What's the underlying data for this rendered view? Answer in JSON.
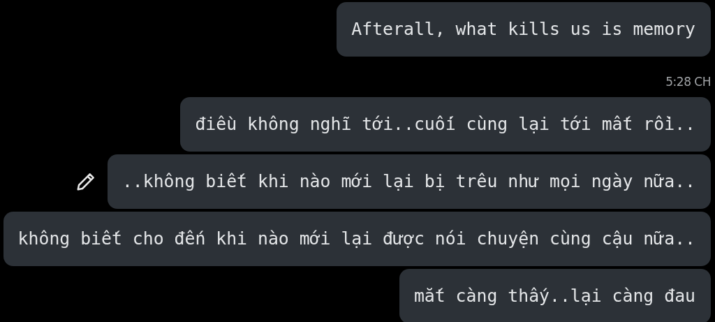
{
  "messages": [
    {
      "kind": "message",
      "text": "Afterall, what kills us is memory",
      "edit_icon": false
    },
    {
      "kind": "time",
      "text": "5:28 CH"
    },
    {
      "kind": "message",
      "text": "điều không nghĩ tới..cuối cùng lại tới mất rồi..",
      "edit_icon": false
    },
    {
      "kind": "message",
      "text": "..không biết khi nào mới lại bị trêu như mọi ngày nữa..",
      "edit_icon": true
    },
    {
      "kind": "message",
      "text": "không biết cho đến khi nào mới lại được nói chuyện cùng cậu nữa..",
      "edit_icon": false
    },
    {
      "kind": "message",
      "text": "mắt càng thấy..lại càng đau",
      "edit_icon": false
    }
  ]
}
